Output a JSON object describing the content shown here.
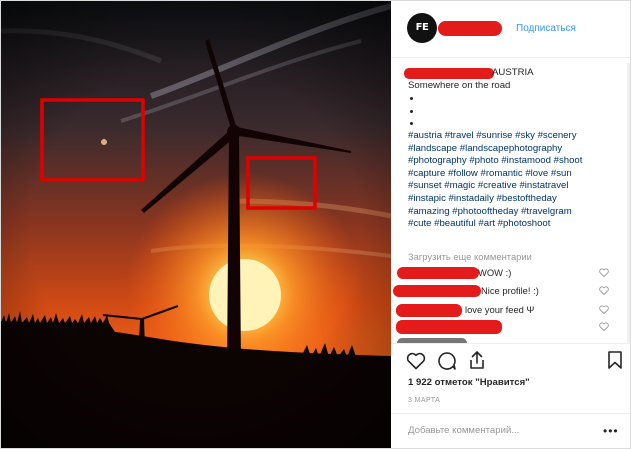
{
  "post": {
    "image_alt": "Wind turbines silhouetted against a red sunset sky",
    "highlight_color": "#e00000"
  },
  "header": {
    "avatar_text": "FE",
    "follow_label": "Подписаться"
  },
  "caption": {
    "location_suffix": "AUSTRIA",
    "line1": "Somewhere on the road",
    "hashtag_lines": [
      "#austria #travel #sunrise #sky #scenery",
      "#landscape #landscapephotography",
      "#photography #photo #instamood #shoot",
      "#capture #follow #romantic #love #sun",
      "#sunset #magic #creative #instatravel",
      "#instapic #instadaily #bestoftheday",
      "#amazing #photooftheday #travelgram",
      "#cute #beautiful #art #photoshoot"
    ]
  },
  "load_more": "Загрузить еще комментарии",
  "comments": [
    {
      "text": "WOW :)"
    },
    {
      "text": "Nice profile! :)"
    },
    {
      "text": "love your feed Ψ"
    },
    {
      "text": ""
    },
    {
      "text": ""
    }
  ],
  "likes": "1 922 отметок \"Нравится\"",
  "date": "3 МАРТА",
  "add_comment": {
    "placeholder": "Добавьте комментарий..."
  },
  "more_icon": "•••",
  "colors": {
    "redaction": "#e31b1b",
    "link": "#3897f0",
    "hashtag": "#003569"
  }
}
